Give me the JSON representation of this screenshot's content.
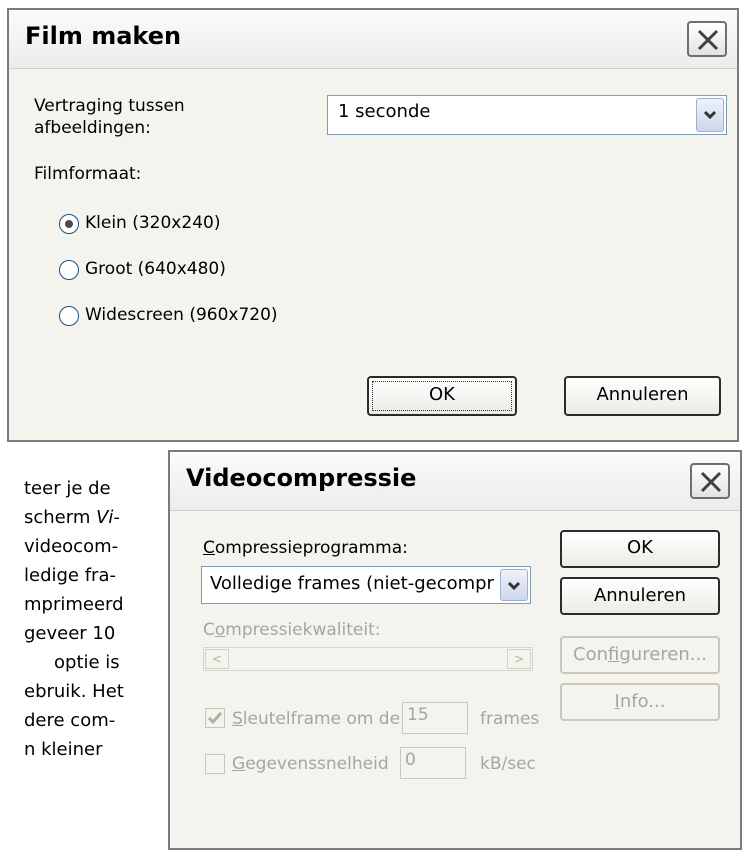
{
  "film_dialog": {
    "title": "Film maken",
    "delay_label_line1": "Vertraging tussen",
    "delay_label_line2": "afbeeldingen:",
    "delay_value": "1 seconde",
    "format_label": "Filmformaat:",
    "options": [
      {
        "label": "Klein (320x240)",
        "selected": true
      },
      {
        "label": "Groot (640x480)",
        "selected": false
      },
      {
        "label": "Widescreen (960x720)",
        "selected": false
      }
    ],
    "ok_label": "OK",
    "cancel_label": "Annuleren"
  },
  "video_dialog": {
    "title": "Videocompressie",
    "program_label_first": "C",
    "program_label_rest": "ompressieprogramma:",
    "program_value": "Volledige frames (niet-gecompr",
    "quality_label_first": "C",
    "quality_label_mid": "o",
    "quality_label_rest": "mpressiekwaliteit:",
    "keyframe_label_first": "S",
    "keyframe_label_rest": "leutelframe om de",
    "keyframe_value": "15",
    "keyframe_unit": "frames",
    "datarate_label_first": "G",
    "datarate_label_rest": "egevenssnelheid",
    "datarate_value": "0",
    "datarate_unit": "kB/sec",
    "ok_label": "OK",
    "cancel_label": "Annuleren",
    "configure_label_pre": "Con",
    "configure_label_u": "f",
    "configure_label_post": "igureren...",
    "info_label_u": "I",
    "info_label_post": "nfo..."
  },
  "body_text": {
    "lines": [
      "teer je de",
      "scherm Vi-",
      "videocom-",
      "ledige fra-",
      "mprimeerd",
      "geveer 10",
      "optie is",
      "ebruik. Het",
      "dere com-",
      "n kleiner"
    ],
    "italic_fragment": "Vi-"
  },
  "colors": {
    "dialog_bg": "#f4f3ee",
    "disabled_text": "#a7a69c",
    "combo_border": "#7f9db9"
  }
}
